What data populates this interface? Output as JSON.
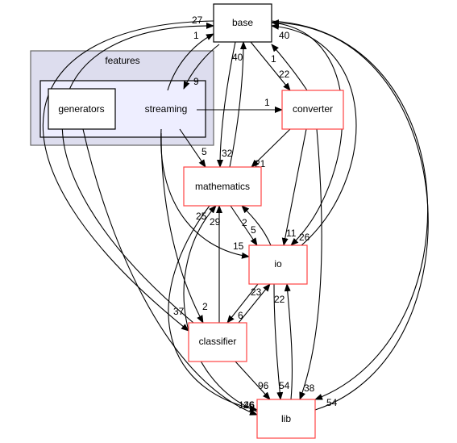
{
  "colors": {
    "normal_border": "#000000",
    "highlight_border": "#ff4444",
    "cluster_fill": "#ddddee",
    "inner_fill": "#eeeeff"
  },
  "cluster": {
    "label": "features"
  },
  "nodes": {
    "base": "base",
    "generators": "generators",
    "streaming": "streaming",
    "converter": "converter",
    "mathematics": "mathematics",
    "io": "io",
    "classifier": "classifier",
    "lib": "lib"
  },
  "edges": [
    {
      "from": "streaming",
      "to": "base",
      "label": "1"
    },
    {
      "from": "base",
      "to": "streaming",
      "label": "9"
    },
    {
      "from": "streaming",
      "to": "converter",
      "label": "1"
    },
    {
      "from": "streaming",
      "to": "mathematics",
      "label": "5"
    },
    {
      "from": "streaming",
      "to": "io",
      "label": "15"
    },
    {
      "from": "streaming",
      "to": "classifier",
      "label": "2"
    },
    {
      "from": "generators",
      "to": "lib",
      "label": "146"
    },
    {
      "from": "base",
      "to": "mathematics",
      "label": "32"
    },
    {
      "from": "mathematics",
      "to": "base",
      "label": "40"
    },
    {
      "from": "base",
      "to": "converter",
      "label": "22"
    },
    {
      "from": "converter",
      "to": "base",
      "label": "1"
    },
    {
      "from": "converter",
      "to": "mathematics",
      "label": "21"
    },
    {
      "from": "converter",
      "to": "io",
      "label": "11"
    },
    {
      "from": "converter",
      "to": "lib",
      "label": "38"
    },
    {
      "from": "mathematics",
      "to": "io",
      "label": "2"
    },
    {
      "from": "io",
      "to": "mathematics",
      "label": "5"
    },
    {
      "from": "base",
      "to": "io",
      "label": "26"
    },
    {
      "from": "io",
      "to": "base",
      "label": "40"
    },
    {
      "from": "lib",
      "to": "mathematics",
      "label": "25"
    },
    {
      "from": "classifier",
      "to": "mathematics",
      "label": "29"
    },
    {
      "from": "mathematics",
      "to": "lib",
      "label": "26"
    },
    {
      "from": "classifier",
      "to": "io",
      "label": "23"
    },
    {
      "from": "io",
      "to": "classifier",
      "label": "6"
    },
    {
      "from": "io",
      "to": "lib",
      "label": "54"
    },
    {
      "from": "lib",
      "to": "io",
      "label": "22"
    },
    {
      "from": "classifier",
      "to": "lib",
      "label": "96"
    },
    {
      "from": "base",
      "to": "classifier",
      "label": "37"
    },
    {
      "from": "classifier",
      "to": "base",
      "label": "27"
    },
    {
      "from": "base",
      "to": "lib",
      "label": "54"
    }
  ]
}
